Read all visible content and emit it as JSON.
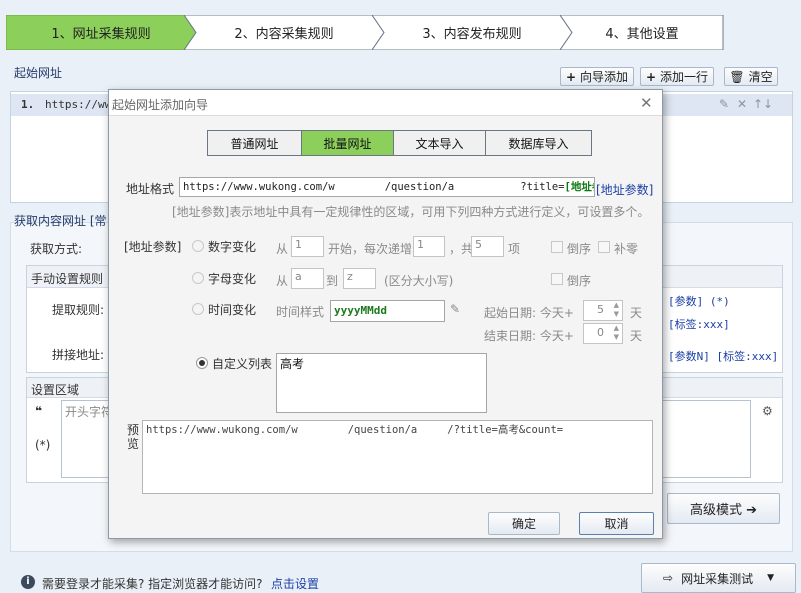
{
  "steps": [
    {
      "label": "1、网址采集规则",
      "active": true
    },
    {
      "label": "2、内容采集规则",
      "active": false
    },
    {
      "label": "3、内容发布规则",
      "active": false
    },
    {
      "label": "4、其他设置",
      "active": false
    }
  ],
  "colors": {
    "active_step": "#8ccf5b",
    "accent_green": "#8ccf5b",
    "link_blue": "#1b3fa8"
  },
  "start_url": {
    "section_label": "起始网址",
    "wizard_add_label": "向导添加",
    "add_row_label": "添加一行",
    "clear_label": "清空",
    "row_index": "1.",
    "row_url": "https://www"
  },
  "content_url": {
    "section_label": "获取内容网址 [常",
    "method_label": "获取方式:",
    "manual_rules_label": "手动设置规则",
    "extract_rule_label": "提取规则:",
    "join_url_label": "拼接地址:",
    "params_right_1": "[参数] (*)",
    "params_right_2": "[标签:xxx]",
    "params_right_3": "[参数N] [标签:xxx]",
    "settings_area_label": "设置区域",
    "quote_icon_label": "❝",
    "wildcard_label": "(*)",
    "prefix_placeholder": "开头字符",
    "advanced_mode_label": "高级模式 ➔"
  },
  "footer": {
    "login_hint": "需要登录才能采集? 指定浏览器才能访问?",
    "settings_link": "点击设置",
    "test_button": "网址采集测试"
  },
  "dialog": {
    "title": "起始网址添加向导",
    "tabs": [
      "普通网址",
      "批量网址",
      "文本导入",
      "数据库导入"
    ],
    "active_tab": 1,
    "url_format_label": "地址格式",
    "url_format_value_start": "https://www.wukong.com/w",
    "url_format_value_mid": "/question/a",
    "url_format_value_end": "?title=",
    "url_format_highlight": "[地址参",
    "url_param_link": "[地址参数]",
    "hint": "[地址参数]表示地址中具有一定规律性的区域，可用下列四种方式进行定义，可设置多个。",
    "param_label": "[地址参数]",
    "number_change": {
      "label": "数字变化",
      "from_label": "从",
      "from_value": "1",
      "step_label": "开始，每次递增",
      "step_value": "1",
      "total_label": "，共",
      "total_value": "5",
      "unit": "项",
      "reverse_label": "倒序",
      "pad_label": "补零"
    },
    "letter_change": {
      "label": "字母变化",
      "from_label": "从",
      "from_value": "a",
      "to_label": "到",
      "to_value": "z",
      "case_label": "(区分大小写)",
      "reverse_label": "倒序"
    },
    "time_change": {
      "label": "时间变化",
      "style_label": "时间样式",
      "style_value": "yyyyMMdd",
      "start_label": "起始日期: 今天+",
      "start_value": "5",
      "start_unit": "天",
      "end_label": "结束日期: 今天+",
      "end_value": "0",
      "end_unit": "天"
    },
    "custom_list": {
      "label": "自定义列表",
      "value": "高考",
      "selected": true
    },
    "preview_label_1": "预",
    "preview_label_2": "览",
    "preview_value_start": "https://www.wukong.com/w",
    "preview_value_mid": "/question/a",
    "preview_value_end": "/?title=高考&count=",
    "ok_label": "确定",
    "cancel_label": "取消"
  }
}
